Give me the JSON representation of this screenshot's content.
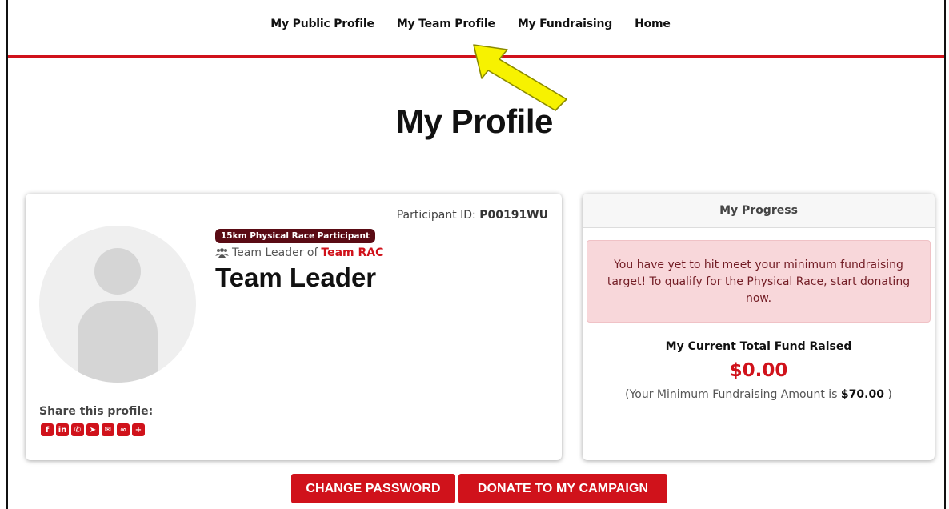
{
  "nav": {
    "items": [
      "My Public Profile",
      "My Team Profile",
      "My Fundraising",
      "Home"
    ]
  },
  "page": {
    "title": "My Profile"
  },
  "profile": {
    "participant_id_label": "Participant ID:",
    "participant_id": "P00191WU",
    "badge": "15km Physical Race Participant",
    "leader_prefix": "Team Leader of",
    "team_name": "Team RAC",
    "name": "Team Leader",
    "share_label": "Share this profile:",
    "share_icons": [
      "facebook-icon",
      "linkedin-icon",
      "whatsapp-icon",
      "telegram-icon",
      "email-icon",
      "link-icon",
      "plus-icon"
    ]
  },
  "progress": {
    "header": "My Progress",
    "alert": "You have yet to hit meet your minimum fundraising target! To qualify for the Physical Race, start donating now.",
    "fund_label": "My Current Total Fund Raised",
    "fund_amount": "$0.00",
    "min_prefix": "(Your Minimum Fundraising Amount is",
    "min_amount": "$70.00",
    "min_suffix": ")"
  },
  "buttons": {
    "change_password": "CHANGE PASSWORD",
    "donate": "DONATE TO MY CAMPAIGN"
  },
  "colors": {
    "accent": "#d0121b",
    "badge": "#5a0b14",
    "alert_bg": "#f8d7da",
    "alert_text": "#721c24",
    "arrow": "#f7f200"
  }
}
